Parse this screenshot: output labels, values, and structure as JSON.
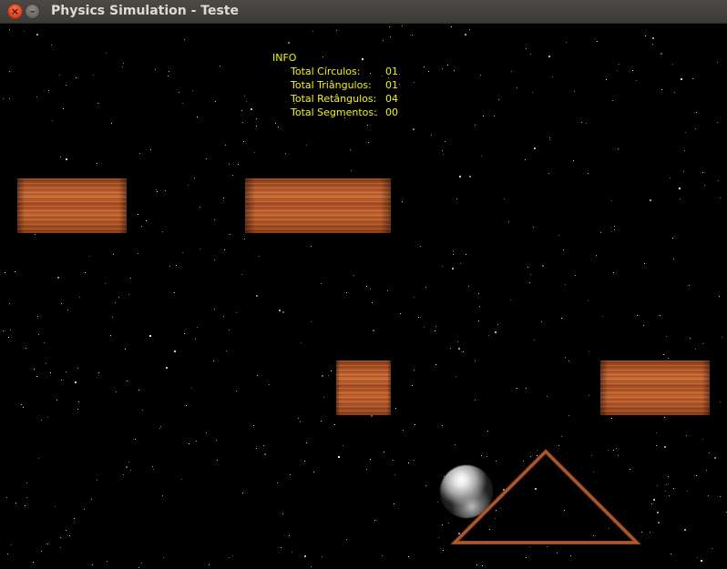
{
  "window": {
    "title": "Physics Simulation - Teste",
    "close_glyph": "×",
    "minimize_glyph": "–"
  },
  "info": {
    "heading": "INFO",
    "rows": [
      {
        "label": "Total Círculos:",
        "value": "01"
      },
      {
        "label": "Total Triângulos:",
        "value": "01"
      },
      {
        "label": "Total Retângulos:",
        "value": "04"
      },
      {
        "label": "Total Segmentos:",
        "value": "00"
      }
    ]
  },
  "colors": {
    "background": "#000000",
    "info_text": "#f2f21a",
    "wood": "#b4582a",
    "triangle_stroke": "#9a4a22"
  },
  "icons": {
    "close": "close-icon",
    "minimize": "minimize-icon"
  }
}
